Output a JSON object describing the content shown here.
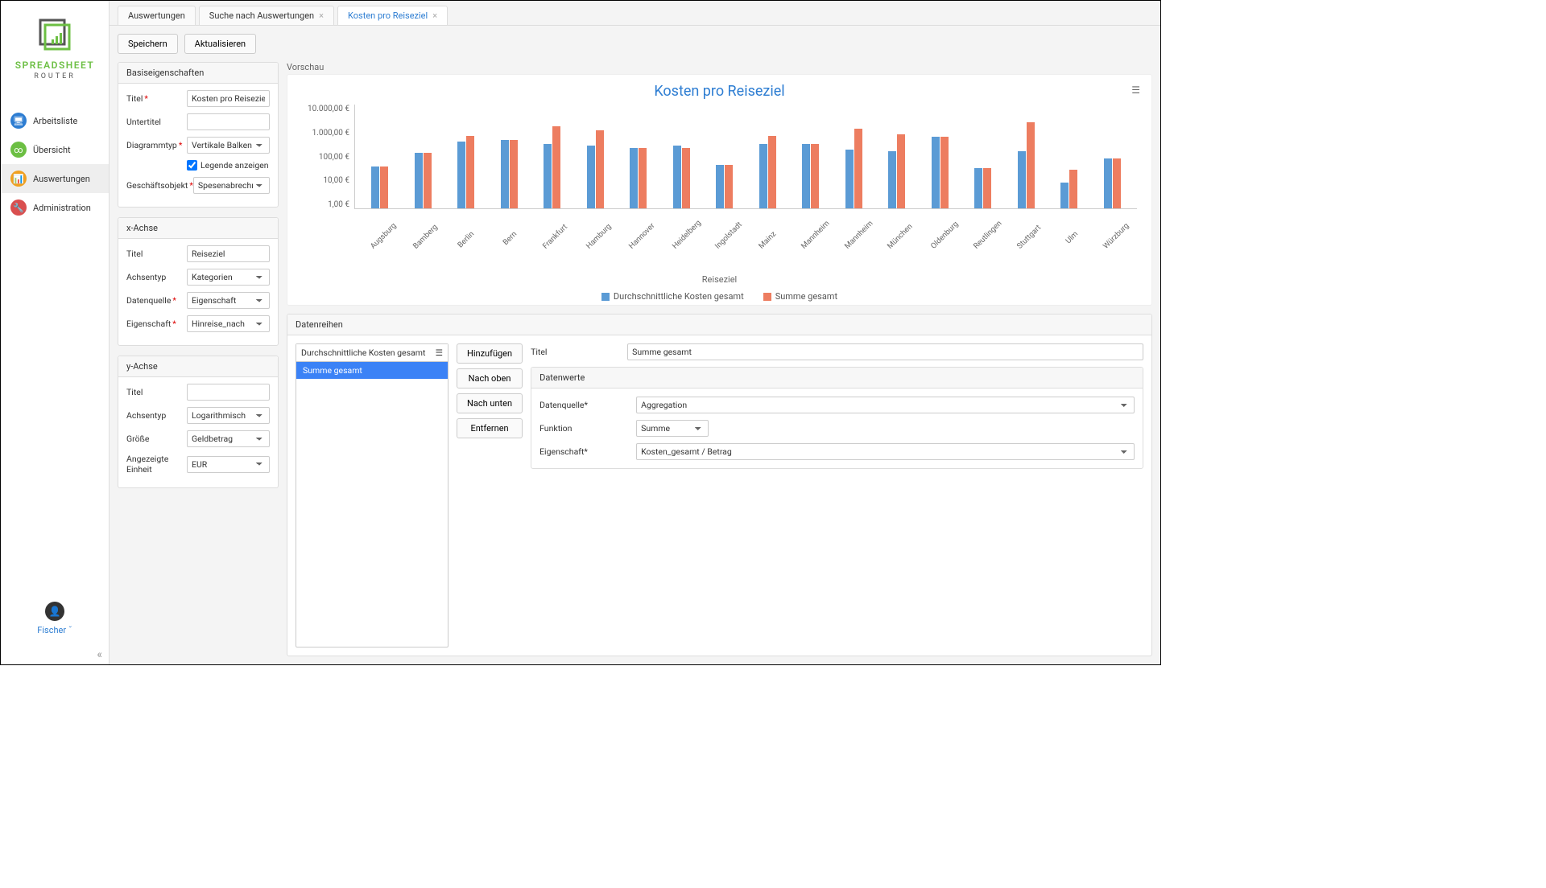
{
  "brand": {
    "main": "SPREADSHEET",
    "sub": "ROUTER"
  },
  "nav": {
    "items": [
      {
        "label": "Arbeitsliste",
        "icon": "monitor",
        "color": "blue"
      },
      {
        "label": "Übersicht",
        "icon": "link",
        "color": "green"
      },
      {
        "label": "Auswertungen",
        "icon": "bars",
        "color": "orange"
      },
      {
        "label": "Administration",
        "icon": "wrench",
        "color": "red"
      }
    ]
  },
  "user": {
    "name": "Fischer",
    "suffix": "ˇ"
  },
  "tabs": [
    {
      "label": "Auswertungen"
    },
    {
      "label": "Suche nach Auswertungen",
      "closable": true
    },
    {
      "label": "Kosten pro Reiseziel",
      "closable": true,
      "active": true
    }
  ],
  "toolbar": {
    "save": "Speichern",
    "refresh": "Aktualisieren"
  },
  "panels": {
    "basic": {
      "title": "Basiseigenschaften",
      "fields": {
        "title_label": "Titel",
        "title_value": "Kosten pro Reiseziel",
        "subtitle_label": "Untertitel",
        "subtitle_value": "",
        "charttype_label": "Diagrammtyp",
        "charttype_value": "Vertikale Balken",
        "legend_label": "Legende anzeigen",
        "bizobj_label": "Geschäftsobjekt",
        "bizobj_value": "Spesenabrechnung"
      }
    },
    "x": {
      "title": "x-Achse",
      "fields": {
        "title_label": "Titel",
        "title_value": "Reiseziel",
        "type_label": "Achsentyp",
        "type_value": "Kategorien",
        "source_label": "Datenquelle",
        "source_value": "Eigenschaft",
        "prop_label": "Eigenschaft",
        "prop_value": "Hinreise_nach"
      }
    },
    "y": {
      "title": "y-Achse",
      "fields": {
        "title_label": "Titel",
        "title_value": "",
        "type_label": "Achsentyp",
        "type_value": "Logarithmisch",
        "size_label": "Größe",
        "size_value": "Geldbetrag",
        "unit_label": "Angezeigte Einheit",
        "unit_value": "EUR"
      }
    }
  },
  "preview_label": "Vorschau",
  "chart": {
    "title": "Kosten pro Reiseziel",
    "x_title": "Reiseziel",
    "legend": {
      "s1": "Durchschnittliche Kosten gesamt",
      "s2": "Summe gesamt"
    },
    "y_ticks": [
      "10.000,00 €",
      "1.000,00 €",
      "100,00 €",
      "10,00 €",
      "1,00 €"
    ]
  },
  "chart_data": {
    "type": "bar",
    "title": "Kosten pro Reiseziel",
    "xlabel": "Reiseziel",
    "ylabel": "",
    "yscale": "log",
    "ylim": [
      1,
      10000
    ],
    "y_unit": "EUR",
    "categories": [
      "Augsburg",
      "Bamberg",
      "Berlin",
      "Bern",
      "Frankfurt",
      "Hamburg",
      "Hannover",
      "Heidelberg",
      "Ingolstadt",
      "Mainz",
      "Mannheim",
      "Mannheim",
      "München",
      "Oldenburg",
      "Reutlingen",
      "Stuttgart",
      "Ulm",
      "Würzburg"
    ],
    "series": [
      {
        "name": "Durchschnittliche Kosten gesamt",
        "color": "#5b9bd5",
        "values": [
          40,
          130,
          350,
          400,
          300,
          250,
          200,
          250,
          45,
          300,
          300,
          180,
          150,
          550,
          35,
          150,
          10,
          80
        ]
      },
      {
        "name": "Summe gesamt",
        "color": "#ed7d60",
        "values": [
          40,
          130,
          600,
          400,
          1400,
          1000,
          200,
          200,
          45,
          600,
          300,
          1100,
          700,
          550,
          35,
          2000,
          30,
          80
        ]
      }
    ]
  },
  "dataseries": {
    "title": "Datenreihen",
    "list_header": "Durchschnittliche Kosten gesamt",
    "items": [
      "Summe gesamt"
    ],
    "actions": {
      "add": "Hinzufügen",
      "up": "Nach oben",
      "down": "Nach unten",
      "remove": "Entfernen"
    },
    "form": {
      "title_label": "Titel",
      "title_value": "Summe gesamt",
      "values_title": "Datenwerte",
      "source_label": "Datenquelle",
      "source_value": "Aggregation",
      "func_label": "Funktion",
      "func_value": "Summe",
      "prop_label": "Eigenschaft",
      "prop_value": "Kosten_gesamt / Betrag"
    }
  }
}
